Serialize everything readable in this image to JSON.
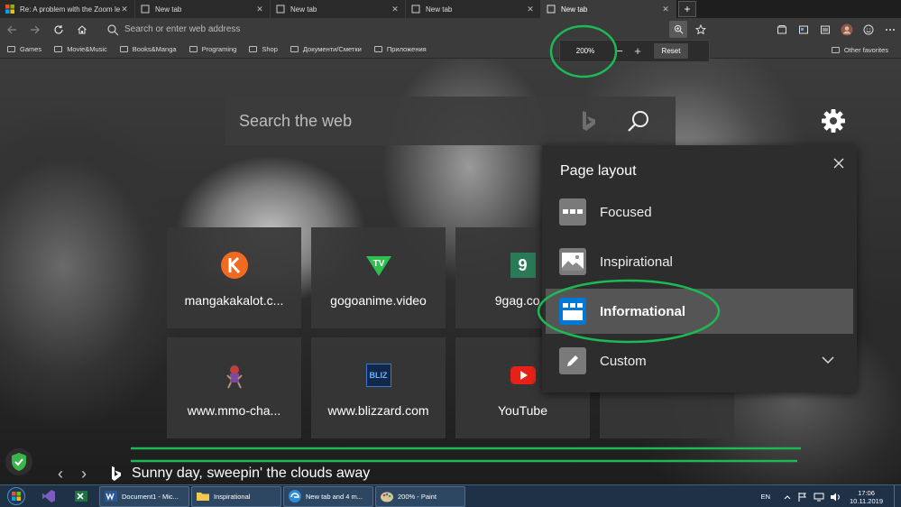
{
  "tabs": [
    {
      "title": "Re: A problem with the Zoom le...",
      "active": false
    },
    {
      "title": "New tab",
      "active": false
    },
    {
      "title": "New tab",
      "active": false
    },
    {
      "title": "New tab",
      "active": false
    },
    {
      "title": "New tab",
      "active": true
    }
  ],
  "addressbar": {
    "placeholder": "Search or enter web address"
  },
  "favorites": {
    "items": [
      "Games",
      "Movie&Music",
      "Books&Manga",
      "Programing",
      "Shop",
      "Документи/Сметки",
      "Приложения"
    ],
    "other": "Other favorites"
  },
  "zoom": {
    "level": "200%",
    "minus": "−",
    "plus": "+",
    "reset_label": "Reset"
  },
  "search": {
    "placeholder": "Search the web"
  },
  "tiles": [
    {
      "label": "mangakakalot.c...",
      "icon": "mangakakalot-icon"
    },
    {
      "label": "gogoanime.video",
      "icon": "gogoanime-icon"
    },
    {
      "label": "9gag.co...",
      "icon": "9gag-icon",
      "icon_text": "9"
    },
    {
      "label": "www.mmo-cha...",
      "icon": "mmo-champion-icon"
    },
    {
      "label": "www.blizzard.com",
      "icon": "blizzard-icon",
      "icon_text": "BLIZ"
    },
    {
      "label": "YouTube",
      "icon": "youtube-icon"
    }
  ],
  "page_layout": {
    "title": "Page layout",
    "options": [
      {
        "label": "Focused",
        "selected": false
      },
      {
        "label": "Inspirational",
        "selected": false
      },
      {
        "label": "Informational",
        "selected": true
      },
      {
        "label": "Custom",
        "selected": false
      }
    ]
  },
  "caption": {
    "text": "Sunny day, sweepin' the clouds away"
  },
  "taskbar": {
    "items": [
      "Document1 - Mic...",
      "Inspirational",
      "New tab and 4 m...",
      "200% - Paint"
    ],
    "lang": "EN",
    "time": "17:06",
    "date": "10.11.2019"
  },
  "colors": {
    "accent": "#0078d7",
    "annotation": "#1db954",
    "panel": "#2d2d2d"
  }
}
